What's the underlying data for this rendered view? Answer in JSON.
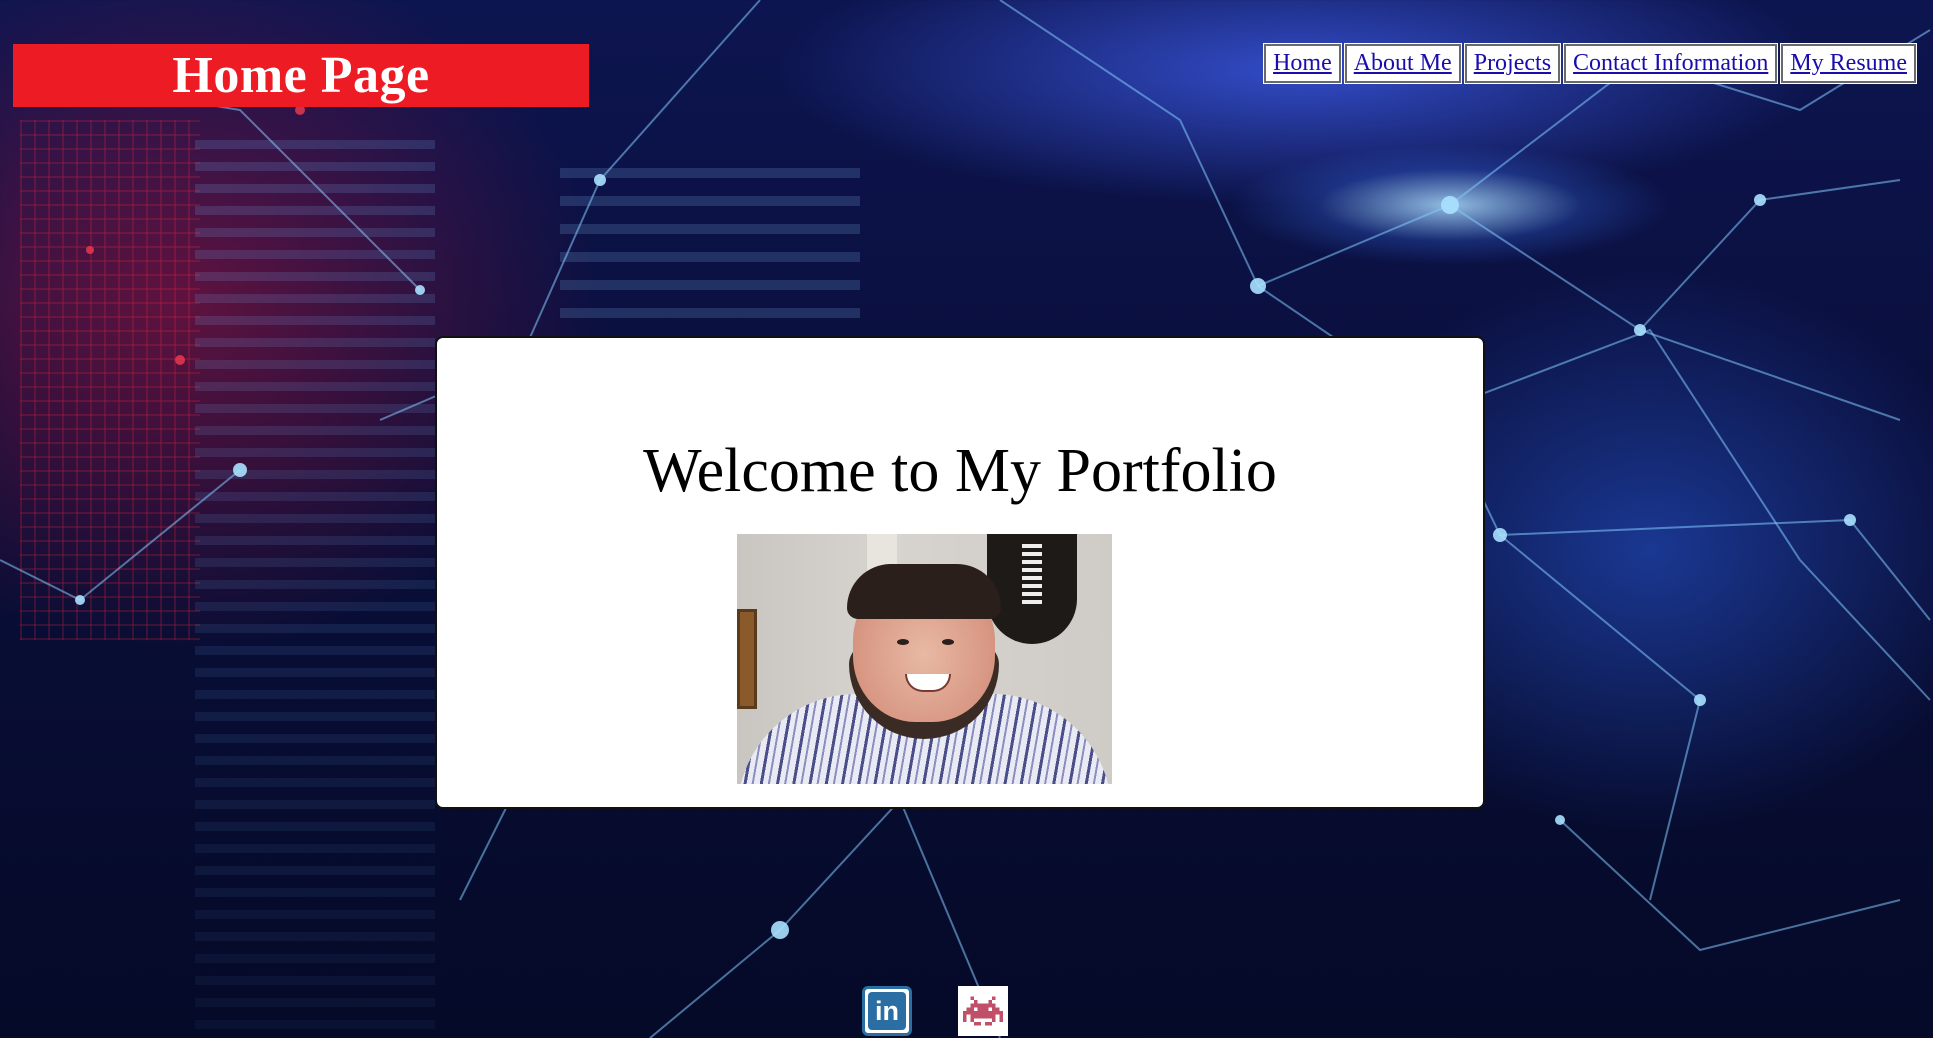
{
  "header": {
    "title": "Home Page"
  },
  "nav": {
    "items": [
      {
        "label": "Home"
      },
      {
        "label": "About Me"
      },
      {
        "label": "Projects"
      },
      {
        "label": "Contact Information"
      },
      {
        "label": "My Resume"
      }
    ]
  },
  "main": {
    "heading": "Welcome to My Portfolio",
    "photo_alt": "Portfolio owner photo"
  },
  "footer": {
    "social": [
      {
        "icon": "linkedin-icon",
        "label": "in"
      },
      {
        "icon": "space-invader-icon"
      }
    ]
  },
  "colors": {
    "header_banner": "#ed1c24",
    "header_text": "#ffffff",
    "link": "#1a0dab",
    "card_background": "#ffffff",
    "linkedin_blue": "#2a6ea3",
    "invader_pink": "#c0506a"
  }
}
